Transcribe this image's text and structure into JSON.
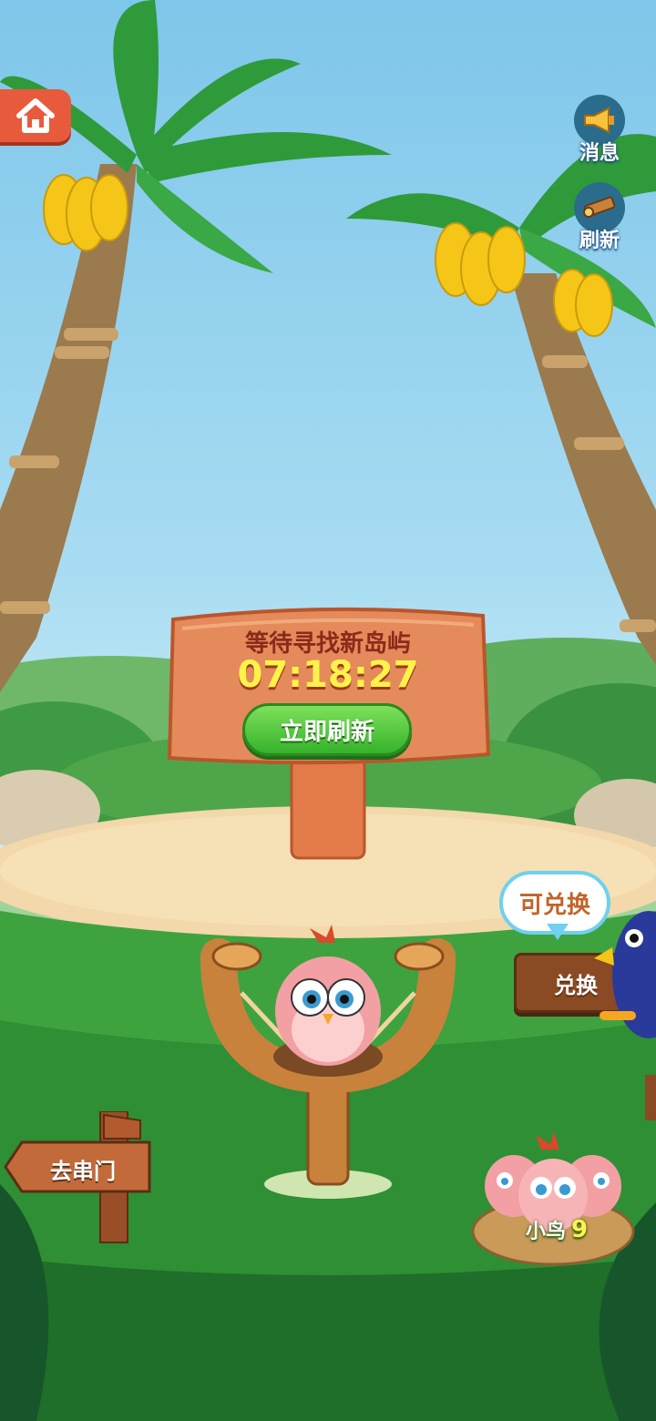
{
  "topbar": {
    "home_icon": "house-icon",
    "messages": {
      "label": "消息",
      "icon": "megaphone-icon"
    },
    "refresh": {
      "label": "刷新",
      "icon": "telescope-icon"
    }
  },
  "signboard": {
    "title": "等待寻找新岛屿",
    "countdown": "07:18:27",
    "refresh_now_label": "立即刷新"
  },
  "exchange": {
    "bubble_text": "可兑换",
    "button_label": "兑换"
  },
  "visit": {
    "label": "去串门"
  },
  "nest": {
    "label": "小鸟",
    "count": "9"
  },
  "colors": {
    "sign_wood": "#e58a5a",
    "sign_title": "#8a2a1a",
    "countdown": "#fff34a",
    "button_green": "#35b22b",
    "home_button": "#e85a3c"
  }
}
